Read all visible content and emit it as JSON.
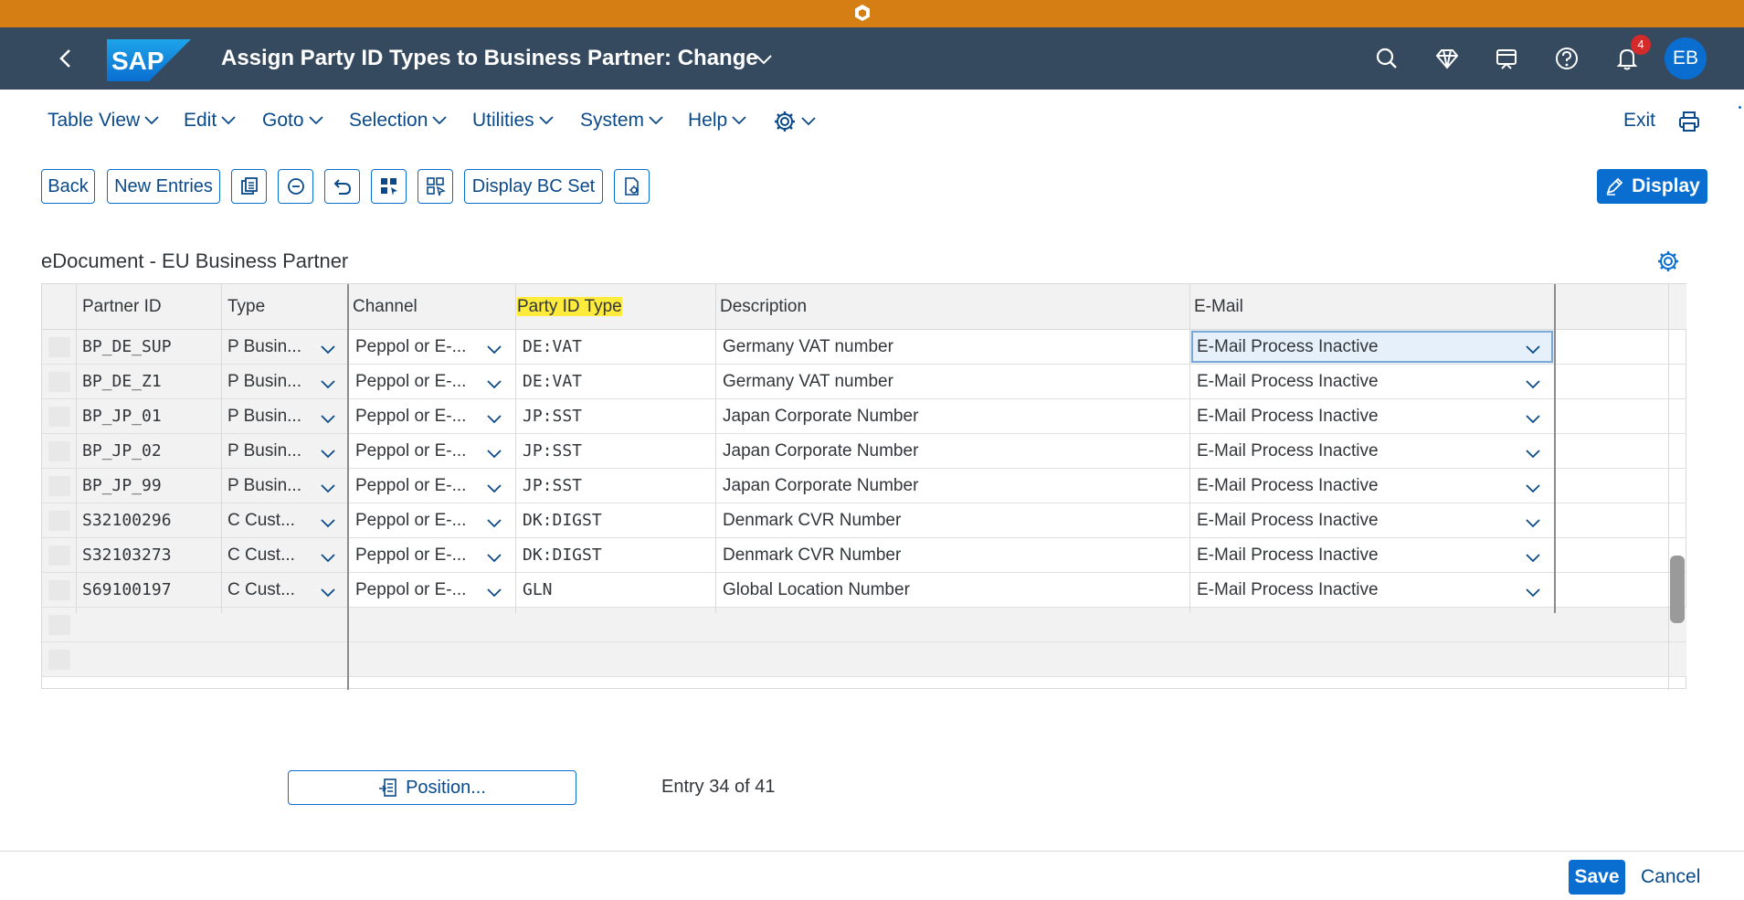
{
  "colors": {
    "top_strip": "#d47e14",
    "shellbar": "#354a5f",
    "accent": "#0a6ed1",
    "highlight": "#ffeb3b",
    "badge": "#d52a2a"
  },
  "shell": {
    "title": "Assign Party ID Types to Business Partner: Change",
    "logo_text": "SAP",
    "notification_count": "4",
    "avatar_initials": "EB",
    "icons": [
      "search-icon",
      "diamond-icon",
      "apps-icon",
      "help-icon",
      "bell-icon"
    ]
  },
  "menu": {
    "items": [
      "Table View",
      "Edit",
      "Goto",
      "Selection",
      "Utilities",
      "System",
      "Help"
    ],
    "exit_label": "Exit"
  },
  "toolbar": {
    "back_label": "Back",
    "new_entries_label": "New Entries",
    "display_bc_set_label": "Display BC Set",
    "display_label": "Display"
  },
  "table": {
    "title": "eDocument - EU Business Partner",
    "columns": [
      "Partner ID",
      "Type",
      "Channel",
      "Party ID Type",
      "Description",
      "E-Mail"
    ],
    "rows": [
      {
        "partner_id": "BP_DE_SUP",
        "type": "P Busin...",
        "channel": "Peppol or E-...",
        "party_id_type": "DE:VAT",
        "description": "Germany VAT number",
        "email": "E-Mail Process Inactive"
      },
      {
        "partner_id": "BP_DE_Z1",
        "type": "P Busin...",
        "channel": "Peppol or E-...",
        "party_id_type": "DE:VAT",
        "description": "Germany VAT number",
        "email": "E-Mail Process Inactive"
      },
      {
        "partner_id": "BP_JP_01",
        "type": "P Busin...",
        "channel": "Peppol or E-...",
        "party_id_type": "JP:SST",
        "description": "Japan Corporate Number",
        "email": "E-Mail Process Inactive"
      },
      {
        "partner_id": "BP_JP_02",
        "type": "P Busin...",
        "channel": "Peppol or E-...",
        "party_id_type": "JP:SST",
        "description": "Japan Corporate Number",
        "email": "E-Mail Process Inactive"
      },
      {
        "partner_id": "BP_JP_99",
        "type": "P Busin...",
        "channel": "Peppol or E-...",
        "party_id_type": "JP:SST",
        "description": "Japan Corporate Number",
        "email": "E-Mail Process Inactive"
      },
      {
        "partner_id": "S32100296",
        "type": "C Cust...",
        "channel": "Peppol or E-...",
        "party_id_type": "DK:DIGST",
        "description": "Denmark CVR Number",
        "email": "E-Mail Process Inactive"
      },
      {
        "partner_id": "S32103273",
        "type": "C Cust...",
        "channel": "Peppol or E-...",
        "party_id_type": "DK:DIGST",
        "description": "Denmark CVR Number",
        "email": "E-Mail Process Inactive"
      },
      {
        "partner_id": "S69100197",
        "type": "C Cust...",
        "channel": "Peppol or E-...",
        "party_id_type": "GLN",
        "description": "Global Location Number",
        "email": "E-Mail Process Inactive"
      }
    ],
    "empty_rows": 2,
    "selected_row": 0
  },
  "footer": {
    "position_label": "Position...",
    "entry_info": "Entry 34 of 41",
    "save_label": "Save",
    "cancel_label": "Cancel"
  }
}
